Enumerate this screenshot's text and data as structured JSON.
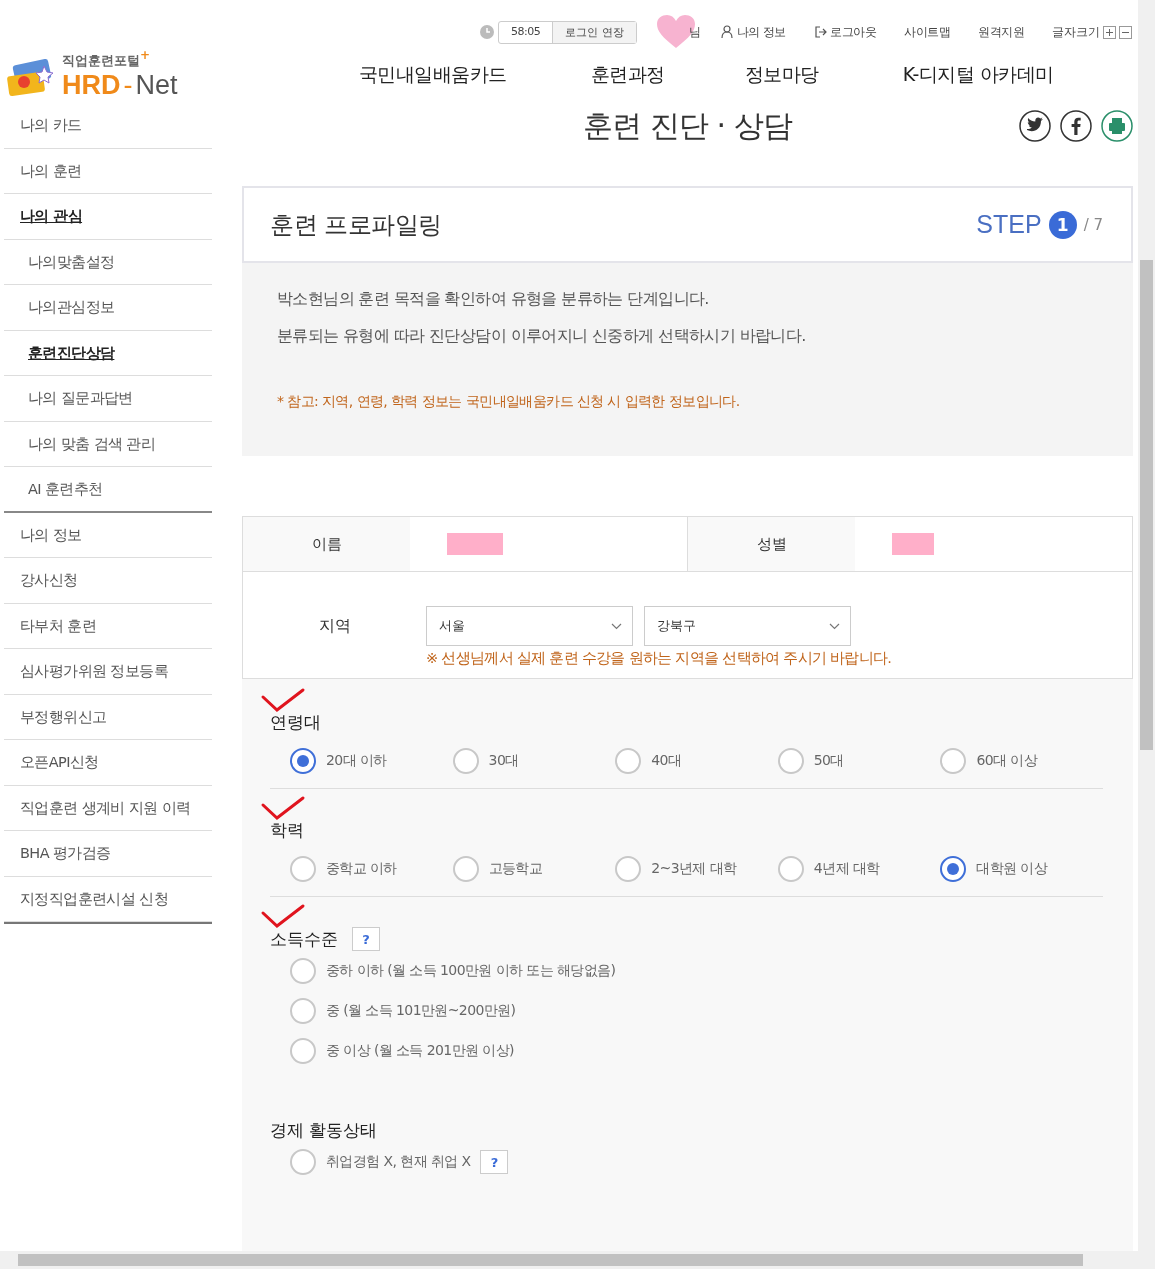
{
  "top_bar": {
    "timer": "58:05",
    "extend_button": "로그인 연장",
    "user_suffix": "님",
    "links": [
      "나의 정보",
      "로그아웃",
      "사이트맵",
      "원격지원"
    ],
    "font_size_label": "글자크기"
  },
  "logo": {
    "caption": "직업훈련포털",
    "plus": "+",
    "name_a": "HRD",
    "dash": "-",
    "name_b": "Net"
  },
  "nav": [
    "국민내일배움카드",
    "훈련과정",
    "정보마당",
    "K-디지털 아카데미"
  ],
  "page_title": "훈련 진단 · 상담",
  "sidebar": [
    {
      "label": "나의 카드",
      "selected": false
    },
    {
      "label": "나의 훈련",
      "selected": false
    },
    {
      "label": "나의 관심",
      "selected": true,
      "children": [
        {
          "label": "나의맞춤설정",
          "selected": false
        },
        {
          "label": "나의관심정보",
          "selected": false
        },
        {
          "label": "훈련진단상담",
          "selected": true
        },
        {
          "label": "나의 질문과답변",
          "selected": false
        },
        {
          "label": "나의 맞춤 검색 관리",
          "selected": false
        },
        {
          "label": "AI 훈련추천",
          "selected": false
        }
      ]
    },
    {
      "label": "나의 정보",
      "selected": false
    },
    {
      "label": "강사신청",
      "selected": false
    },
    {
      "label": "타부처 훈련",
      "selected": false
    },
    {
      "label": "심사평가위원 정보등록",
      "selected": false
    },
    {
      "label": "부정행위신고",
      "selected": false
    },
    {
      "label": "오픈API신청",
      "selected": false
    },
    {
      "label": "직업훈련 생계비 지원 이력",
      "selected": false
    },
    {
      "label": "BHA 평가검증",
      "selected": false
    },
    {
      "label": "지정직업훈련시설 신청",
      "selected": false
    }
  ],
  "section": {
    "title": "훈련 프로파일링",
    "step_label": "STEP",
    "step": "1",
    "step_total": "/ 7"
  },
  "intro": {
    "lines": [
      "박소현님의 훈련 목적을 확인하여 유형을 분류하는 단계입니다.",
      "분류되는 유형에 따라 진단상담이 이루어지니 신중하게 선택하시기 바랍니다."
    ],
    "note": "* 참고: 지역, 연령, 학력 정보는 국민내일배움카드 신청 시 입력한 정보입니다."
  },
  "profile": {
    "name_label": "이름",
    "gender_label": "성별",
    "region_label": "지역",
    "city": "서울",
    "district": "강북구",
    "region_note": "※ 선생님께서 실제 훈련 수강을 원하는 지역을 선택하여 주시기 바랍니다."
  },
  "questions": [
    {
      "title": "연령대",
      "kind": "row",
      "marked": true,
      "options": [
        {
          "label": "20대 이하",
          "selected": true
        },
        {
          "label": "30대",
          "selected": false
        },
        {
          "label": "40대",
          "selected": false
        },
        {
          "label": "50대",
          "selected": false
        },
        {
          "label": "60대 이상",
          "selected": false
        }
      ]
    },
    {
      "title": "학력",
      "kind": "row",
      "marked": true,
      "options": [
        {
          "label": "중학교 이하",
          "selected": false
        },
        {
          "label": "고등학교",
          "selected": false
        },
        {
          "label": "2~3년제 대학",
          "selected": false
        },
        {
          "label": "4년제 대학",
          "selected": false
        },
        {
          "label": "대학원 이상",
          "selected": true
        }
      ]
    },
    {
      "title": "소득수준",
      "kind": "column",
      "marked": true,
      "help": "?",
      "options": [
        {
          "label": "중하 이하 (월 소득 100만원 이하 또는 해당없음)",
          "selected": false
        },
        {
          "label": "중 (월 소득 101만원~200만원)",
          "selected": false
        },
        {
          "label": "중 이상 (월 소득 201만원 이상)",
          "selected": false
        }
      ]
    },
    {
      "title": "경제 활동상태",
      "kind": "column",
      "marked": false,
      "options": [
        {
          "label": "취업경험 X, 현재 취업 X",
          "selected": false,
          "help": "?"
        }
      ]
    }
  ]
}
